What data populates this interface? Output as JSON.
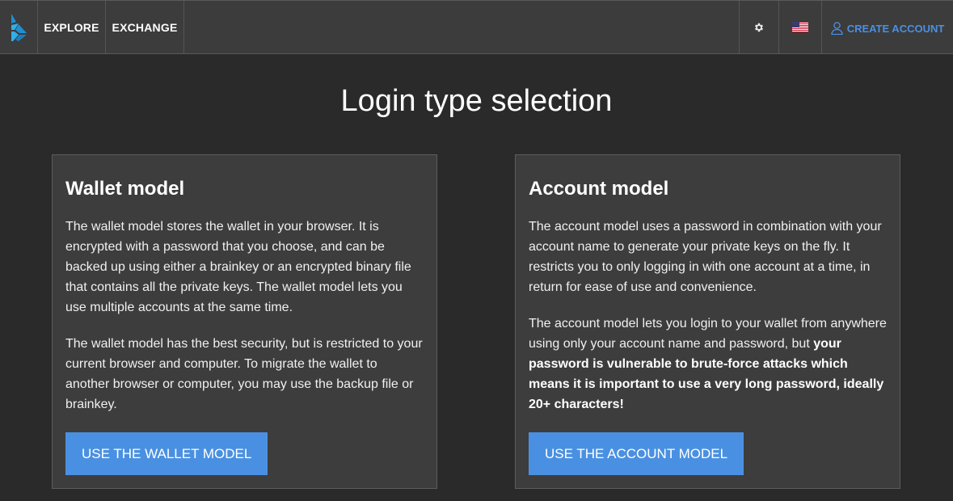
{
  "header": {
    "logo": "bitshares-icon",
    "nav": [
      {
        "label": "EXPLORE"
      },
      {
        "label": "EXCHANGE"
      }
    ],
    "settings_icon": "gear-icon",
    "language_icon": "us-flag-icon",
    "create_account_label": "CREATE ACCOUNT",
    "accent_color": "#4a90e2"
  },
  "page": {
    "title": "Login type selection"
  },
  "wallet": {
    "heading": "Wallet model",
    "p1": "The wallet model stores the wallet in your browser. It is encrypted with a password that you choose, and can be backed up using either a brainkey or an encrypted binary file that contains all the private keys. The wallet model lets you use multiple accounts at the same time.",
    "p2": "The wallet model has the best security, but is restricted to your current browser and computer. To migrate the wallet to another browser or computer, you may use the backup file or brainkey.",
    "button": "USE THE WALLET MODEL"
  },
  "account": {
    "heading": "Account model",
    "p1": "The account model uses a password in combination with your account name to generate your private keys on the fly. It restricts you to only logging in with one account at a time, in return for ease of use and convenience.",
    "p2_plain": "The account model lets you login to your wallet from anywhere using only your account name and password, but ",
    "p2_bold": "your password is vulnerable to brute-force attacks which means it is important to use a very long password, ideally 20+ characters!",
    "button": "USE THE ACCOUNT MODEL"
  }
}
